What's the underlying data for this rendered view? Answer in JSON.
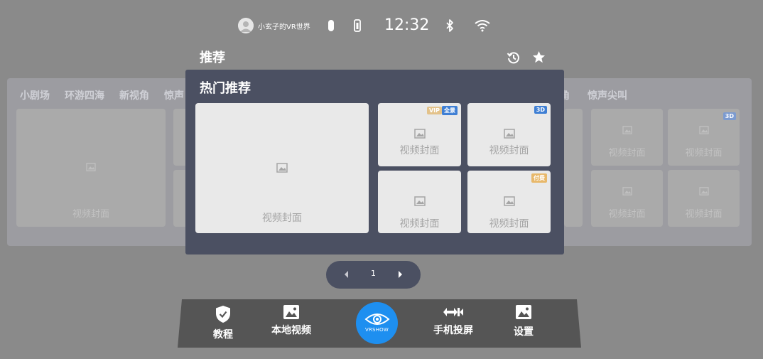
{
  "status_bar": {
    "username": "小玄子的VR世界",
    "time": "12:32"
  },
  "background_panel": {
    "tabs": [
      "小剧场",
      "环游四海",
      "新视角",
      "惊声"
    ],
    "right_tabs": [
      "角",
      "惊声尖叫"
    ],
    "card_label": "视频封面",
    "badge_3d": "3D"
  },
  "section": {
    "title": "推荐"
  },
  "dialog": {
    "title": "热门推荐",
    "cards": [
      {
        "label": "视频封面",
        "badges": []
      },
      {
        "label": "视频封面",
        "badges": [
          "VIP",
          "全景"
        ]
      },
      {
        "label": "视频封面",
        "badges": [
          "3D"
        ]
      },
      {
        "label": "视频封面",
        "badges": []
      },
      {
        "label": "视频封面",
        "badges": [
          "付费"
        ]
      }
    ]
  },
  "pager": {
    "page": "1"
  },
  "dock": {
    "items": [
      "教程",
      "本地视频",
      "手机投屏",
      "设置"
    ],
    "brand": "VRSHOW"
  },
  "colors": {
    "background": "#8a8a8a",
    "dialog": "#4b5062",
    "accent_blue": "#1e8ff0",
    "badge_vip": "#e3c28a",
    "badge_blue": "#3f7fd4",
    "badge_paid": "#e8b86a"
  }
}
